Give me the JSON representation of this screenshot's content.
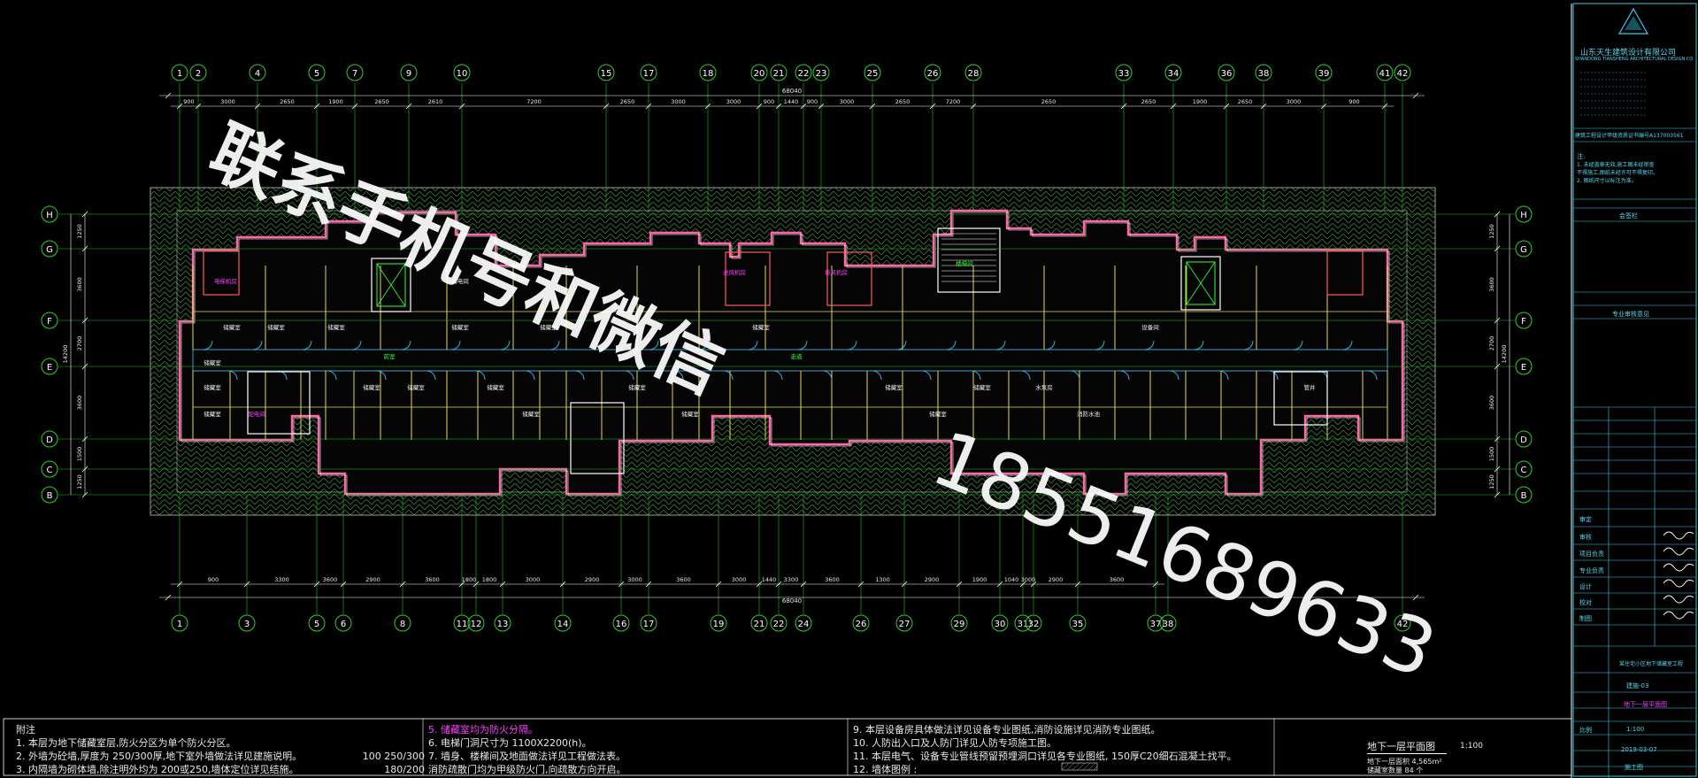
{
  "drawing": {
    "grid_top": [
      "1",
      "2",
      "4",
      "5",
      "7",
      "9",
      "10",
      "15",
      "17",
      "18",
      "20",
      "21",
      "22",
      "23",
      "25",
      "26",
      "28",
      "33",
      "34",
      "36",
      "38",
      "39",
      "41",
      "42"
    ],
    "grid_bottom": [
      "1",
      "3",
      "5",
      "6",
      "8",
      "11",
      "12",
      "13",
      "14",
      "16",
      "17",
      "19",
      "21",
      "22",
      "24",
      "26",
      "27",
      "29",
      "30",
      "31",
      "32",
      "35",
      "37",
      "38",
      "42"
    ],
    "grid_rows": [
      "H",
      "G",
      "F",
      "E",
      "D",
      "C",
      "B"
    ],
    "dims_top": [
      "900",
      "3000",
      "2650",
      "1900",
      "2650",
      "2610",
      "7200",
      "2650",
      "3000",
      "3000",
      "900",
      "1440",
      "900",
      "3000",
      "2650",
      "7200",
      "2650",
      "2650",
      "1900",
      "2650",
      "3000",
      "900"
    ],
    "dims_bottom": [
      "900",
      "3300",
      "3600",
      "2900",
      "3600",
      "1800",
      "1800",
      "3000",
      "2900",
      "3000",
      "3600",
      "3000",
      "1440",
      "3300",
      "3600",
      "1300",
      "2900",
      "1900",
      "1040",
      "3000",
      "2900",
      "3600"
    ],
    "overall_top": "68040",
    "overall_bottom": "68040",
    "dims_side": [
      "1250",
      "3600",
      "2700",
      "3600",
      "1500",
      "1250"
    ],
    "dim_side_total": "14200",
    "room_labels": [
      "储藏室",
      "储藏室",
      "储藏室",
      "储藏室",
      "储藏室",
      "储藏室",
      "储藏室",
      "储藏室",
      "储藏室",
      "储藏室",
      "储藏室",
      "储藏室",
      "储藏室",
      "储藏室",
      "储藏室",
      "储藏室",
      "储藏室",
      "储藏室",
      "电梯机房",
      "配电间",
      "弱电间",
      "送风机房",
      "排风机房",
      "走道",
      "前室",
      "楼梯间",
      "水泵房",
      "消防水池",
      "设备间",
      "管井"
    ],
    "watermark_line1": "联系手机号和微信",
    "watermark_line2": "18551689633"
  },
  "notes": {
    "col1": [
      "附注",
      "1. 本层为地下储藏室层,防火分区为单个防火分区。",
      "2. 外墙为砼墙,厚度为 250/300厚,地下室外墙做法详见建施说明。",
      "3. 内隔墙为砌体墙,除注明外均为 200或250,墙体定位详见结施。"
    ],
    "col1_right": [
      "",
      "",
      "100  250/300",
      "180/200"
    ],
    "col2": [
      "5. 储藏室均为防火分隔。",
      "6. 电梯门洞尺寸为  1100X2200(h)。",
      "7. 墙身、楼梯间及地面做法详见工程做法表。",
      "消防疏散门均为甲级防火门,向疏散方向开启。"
    ],
    "col3": [
      "9. 本层设备房具体做法详见设备专业图纸,消防设施详见消防专业图纸。",
      "10. 人防出入口及人防门详见人防专项施工图。",
      "11. 本层电气、设备专业管线预留预埋洞口详见各专业图纸,  150厚C20细石混凝土找平。",
      "12. 墙体图例 :"
    ],
    "plan_title": "地下一层平面图",
    "plan_scale": "1:100",
    "plan_sub1": "地下一层面积 4,565m²",
    "plan_sub2": "储藏室数量 84 个"
  },
  "title_block": {
    "company": "山东天生建筑设计有限公司",
    "company_en": "SHANDONG TIANSHENG ARCHITECTURAL DESIGN CO.,LTD",
    "cert": "建筑工程设计甲级资质证书编号A137003561",
    "note_head": "注:",
    "note_lines": [
      "1. 未经盖章无效,施工图未经审查",
      "   不得施工,图纸未经许可不得复印。",
      "2. 图纸尺寸以标注为准。"
    ],
    "seal_label": "会签栏",
    "seal_label2": "专业审核意见",
    "roles": [
      "审定",
      "审核",
      "项目负责",
      "专业负责",
      "设计",
      "校对",
      "制图"
    ],
    "project_name": "某住宅小区地下储藏室工程",
    "drawing_name": "地下一层平面图",
    "drawing_no": "建施-03",
    "date": "2019-03-07",
    "stage": "施工图",
    "scale_label": "比例",
    "scale_value": "1:100"
  },
  "colors": {
    "background": "#000000",
    "grid_line": "#22c322",
    "axis_bubble": "#2ad22a",
    "dim_text": "#e8e8e8",
    "wall_outline": "#ff66aa",
    "hatch_green": "#3c7a3c",
    "room_yellow": "#e6d94a",
    "title_block_cyan": "#38cce6",
    "magenta_text": "#ff00ff"
  }
}
